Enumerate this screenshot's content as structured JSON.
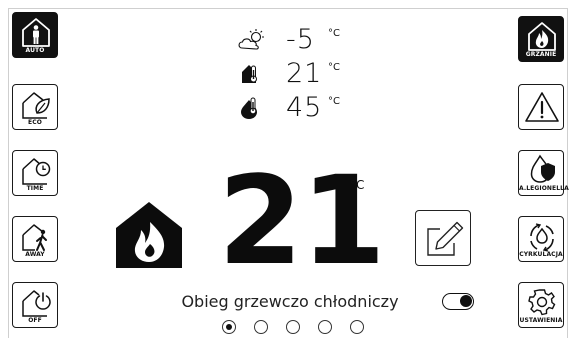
{
  "left_menu": [
    {
      "key": "auto",
      "label": "AUTO",
      "icon": "person-house-icon",
      "active": true
    },
    {
      "key": "eco",
      "label": "ECO",
      "icon": "leaf-house-icon",
      "active": false
    },
    {
      "key": "time",
      "label": "TIME",
      "icon": "clock-house-icon",
      "active": false
    },
    {
      "key": "away",
      "label": "AWAY",
      "icon": "walking-person-house-icon",
      "active": false
    },
    {
      "key": "off",
      "label": "OFF",
      "icon": "power-house-icon",
      "active": false
    }
  ],
  "right_menu": [
    {
      "key": "heating",
      "label": "GRZANIE",
      "icon": "flame-house-icon",
      "active": true
    },
    {
      "key": "alarm",
      "label": "",
      "icon": "warning-icon",
      "active": false
    },
    {
      "key": "legionella",
      "label": "A.LEGIONELLA",
      "icon": "shield-drop-icon",
      "active": false
    },
    {
      "key": "circulation",
      "label": "CYRKULACJA",
      "icon": "circulation-drop-icon",
      "active": false
    },
    {
      "key": "settings",
      "label": "USTAWIENIA",
      "icon": "gear-icon",
      "active": false
    }
  ],
  "readings": {
    "outdoor": {
      "value": "-5",
      "unit": "°C",
      "icon": "partly-cloudy-icon"
    },
    "indoor": {
      "value": "21",
      "unit": "°C",
      "icon": "house-thermometer-icon"
    },
    "water": {
      "value": "45",
      "unit": "°C",
      "icon": "drop-thermometer-icon"
    }
  },
  "main": {
    "setpoint": "21",
    "unit": "°C",
    "mode_icon": "flame-house-icon",
    "edit_icon": "pencil-edit-icon",
    "circuit_name": "Obieg grzewczo chłodniczy",
    "circuit_enabled": true
  },
  "pager": {
    "count": 5,
    "active_index": 0
  },
  "colors": {
    "foreground": "#111111",
    "background": "#ffffff"
  }
}
